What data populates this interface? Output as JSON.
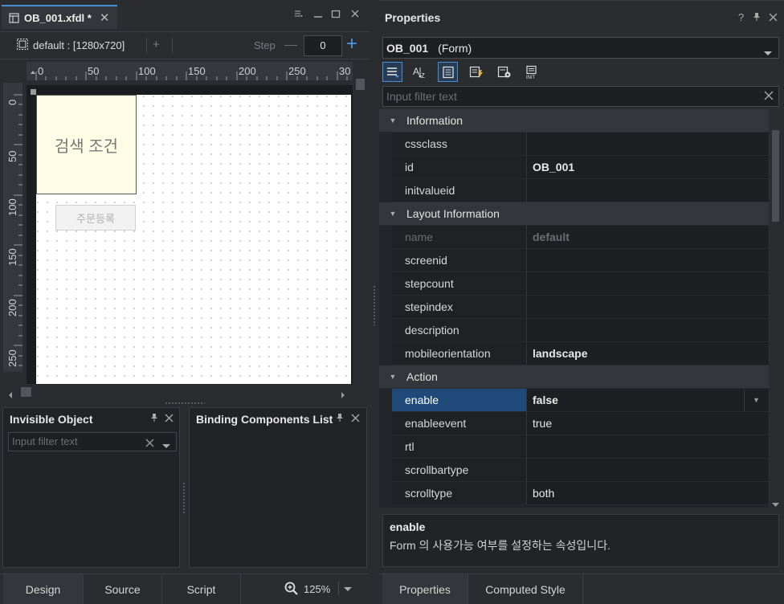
{
  "editor": {
    "tab_title": "OB_001.xfdl *",
    "layout": "default :  [1280x720]",
    "step_label": "Step",
    "step_value": "0",
    "ruler_h": [
      "0",
      "50",
      "100",
      "150",
      "200",
      "250",
      "30"
    ],
    "ruler_v": [
      "0",
      "50",
      "100",
      "150",
      "200",
      "250"
    ],
    "search_box_text": "검색 조건",
    "order_button_text": "주문등록"
  },
  "invisible_panel": {
    "title": "Invisible Object",
    "filter_placeholder": "Input filter text"
  },
  "binding_panel": {
    "title": "Binding Components List"
  },
  "bottom_tabs": {
    "design": "Design",
    "source": "Source",
    "script": "Script",
    "zoom": "125%"
  },
  "properties": {
    "title": "Properties",
    "object_name": "OB_001",
    "object_type": "(Form)",
    "filter_placeholder": "Input filter text",
    "categories": {
      "information": "Information",
      "layout": "Layout Information",
      "action": "Action"
    },
    "rows": {
      "cssclass": {
        "name": "cssclass",
        "value": ""
      },
      "id": {
        "name": "id",
        "value": "OB_001"
      },
      "initvalueid": {
        "name": "initvalueid",
        "value": ""
      },
      "name": {
        "name": "name",
        "value": "default"
      },
      "screenid": {
        "name": "screenid",
        "value": ""
      },
      "stepcount": {
        "name": "stepcount",
        "value": ""
      },
      "stepindex": {
        "name": "stepindex",
        "value": ""
      },
      "description": {
        "name": "description",
        "value": ""
      },
      "mobileorientation": {
        "name": "mobileorientation",
        "value": "landscape"
      },
      "enable": {
        "name": "enable",
        "value": "false"
      },
      "enableevent": {
        "name": "enableevent",
        "value": "true"
      },
      "rtl": {
        "name": "rtl",
        "value": ""
      },
      "scrollbartype": {
        "name": "scrollbartype",
        "value": ""
      },
      "scrolltype": {
        "name": "scrolltype",
        "value": "both"
      }
    },
    "description_title": "enable",
    "description_text": "Form 의 사용가능 여부를 설정하는 속성입니다.",
    "tabs": {
      "properties": "Properties",
      "computed_style": "Computed Style"
    }
  },
  "colors": {
    "accent": "#4a8fd6",
    "selected_row": "#1f4a7a"
  }
}
